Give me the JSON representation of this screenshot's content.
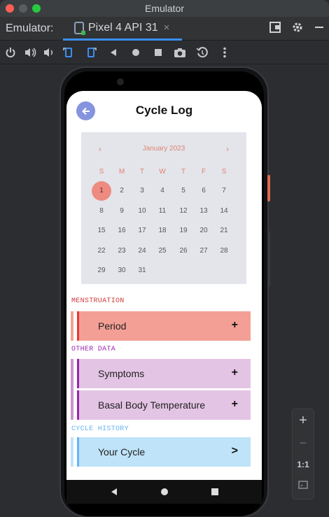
{
  "window": {
    "title": "Emulator"
  },
  "tabbar": {
    "label": "Emulator:",
    "device_tab": "Pixel 4 API 31",
    "close_glyph": "×"
  },
  "toolbar": {
    "icons": [
      "power-icon",
      "volume-up-icon",
      "volume-down-icon",
      "rotate-left-icon",
      "rotate-right-icon",
      "back-icon",
      "home-icon",
      "overview-icon",
      "screenshot-icon",
      "snapshot-icon",
      "more-icon"
    ]
  },
  "app": {
    "title": "Cycle Log",
    "calendar": {
      "month": "January 2023",
      "prev": "‹",
      "next": "›",
      "weekdays": [
        "S",
        "M",
        "T",
        "W",
        "T",
        "F",
        "S"
      ],
      "days": [
        "1",
        "2",
        "3",
        "4",
        "5",
        "6",
        "7",
        "8",
        "9",
        "10",
        "11",
        "12",
        "13",
        "14",
        "15",
        "16",
        "17",
        "18",
        "19",
        "20",
        "21",
        "22",
        "23",
        "24",
        "25",
        "26",
        "27",
        "28",
        "29",
        "30",
        "31"
      ],
      "selected": "1"
    },
    "sections": {
      "menstruation": "MENSTRUATION",
      "other": "OTHER DATA",
      "history": "CYCLE HISTORY"
    },
    "rows": {
      "period": {
        "label": "Period",
        "action": "+"
      },
      "symptoms": {
        "label": "Symptoms",
        "action": "+"
      },
      "bbt": {
        "label": "Basal Body Temperature",
        "action": "+"
      },
      "cycle": {
        "label": "Your Cycle",
        "action": ">"
      }
    },
    "colors": {
      "menstruation": "#f49f96",
      "menstruation_accent": "#e53935",
      "other": "#e4c4e4",
      "other_accent": "#9c27b0",
      "history": "#bfe3f8",
      "history_accent": "#64b5f6",
      "back_button": "#8594de"
    }
  },
  "zoom": {
    "plus": "+",
    "minus": "−",
    "ratio": "1:1"
  }
}
